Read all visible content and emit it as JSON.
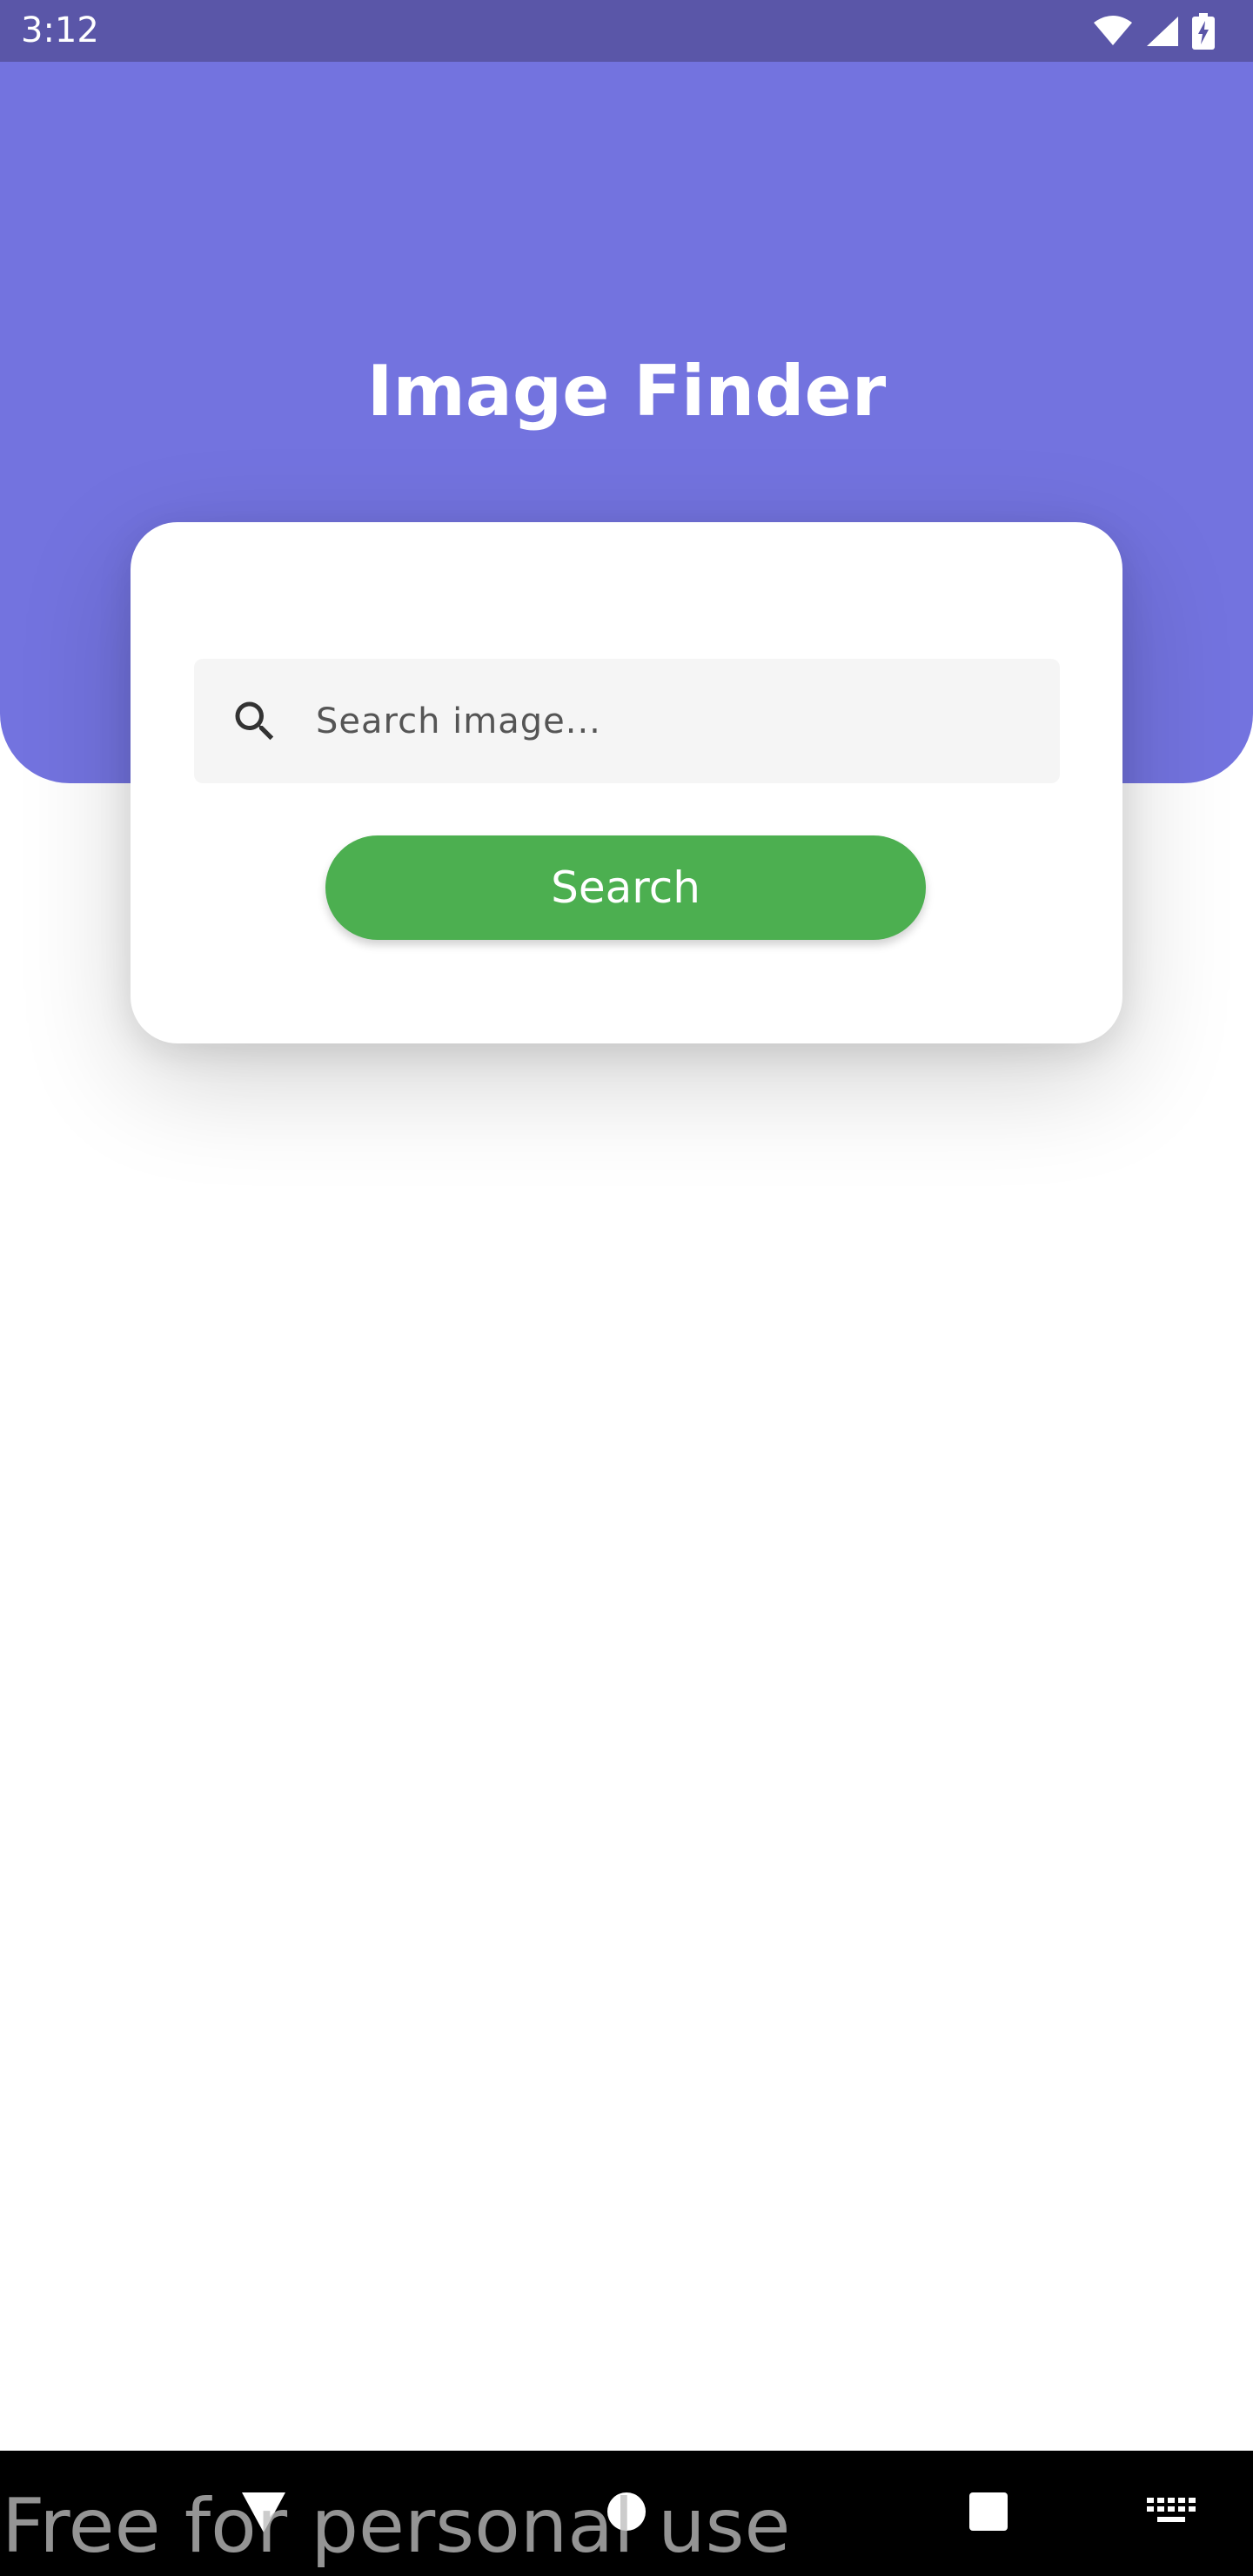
{
  "status_bar": {
    "time": "3:12",
    "icons": [
      "wifi-icon",
      "cellular-signal-icon",
      "battery-charging-icon"
    ]
  },
  "header": {
    "title": "Image Finder",
    "background_color": "#7373df"
  },
  "search": {
    "placeholder": "Search image...",
    "value": "",
    "icon": "search-icon"
  },
  "search_button": {
    "label": "Search",
    "color": "#4caf50"
  },
  "nav_bar": {
    "icons": [
      "back-icon",
      "home-icon",
      "recents-icon",
      "keyboard-icon"
    ]
  },
  "watermark": {
    "text": "Free for personal use"
  }
}
